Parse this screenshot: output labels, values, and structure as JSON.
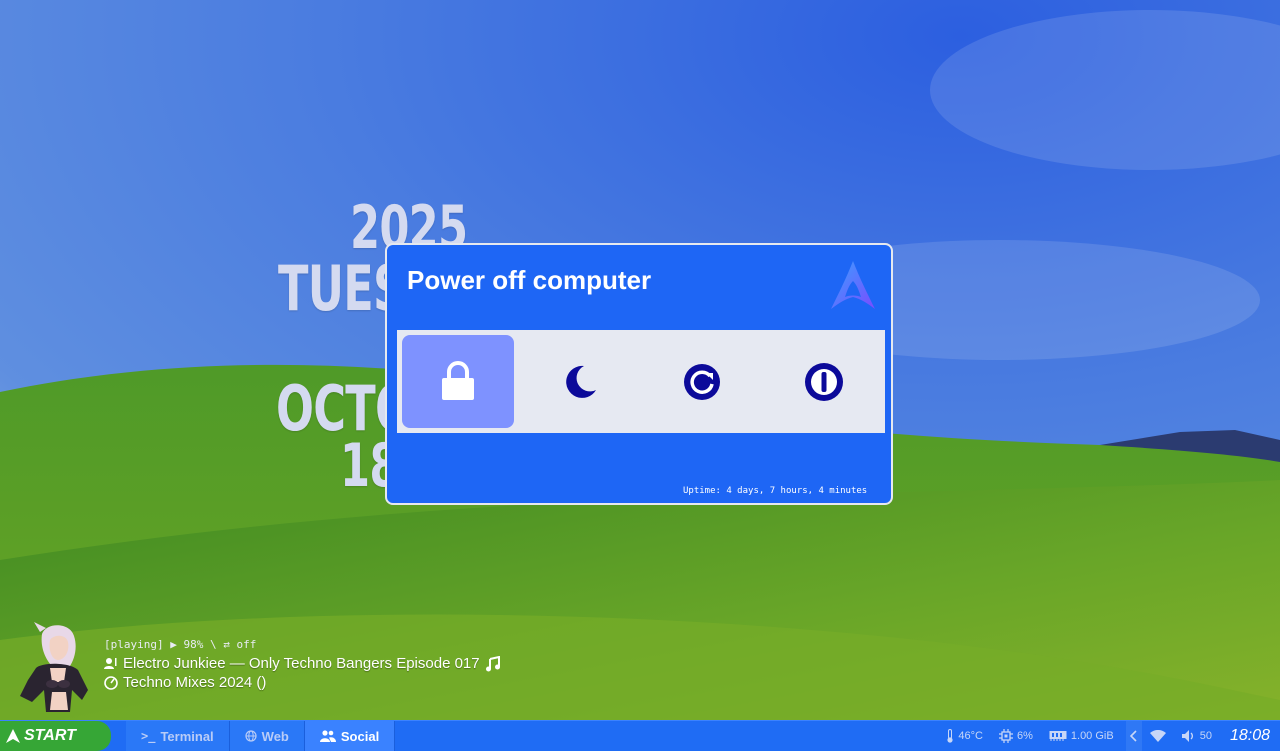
{
  "desktop": {
    "clock": {
      "year": "2025",
      "weekday": "TUESDAY",
      "month": "OCTOBER",
      "date": "18"
    }
  },
  "power_dialog": {
    "title": "Power off computer",
    "options": [
      {
        "name": "lock",
        "icon": "lock-icon",
        "selected": true
      },
      {
        "name": "suspend",
        "icon": "moon-icon",
        "selected": false
      },
      {
        "name": "reboot",
        "icon": "reboot-icon",
        "selected": false
      },
      {
        "name": "shutdown",
        "icon": "power-icon",
        "selected": false
      }
    ],
    "uptime": "Uptime: 4 days, 7 hours, 4 minutes",
    "colors": {
      "background": "#1e66f5",
      "options_bg": "#e6e9f2",
      "selected": "#7e92ff",
      "icon": "#0c0a9a"
    }
  },
  "music": {
    "status": "[playing] ▶ 98% \\ ⇄ off",
    "track": "Electro Junkiee — Only Techno Bangers Episode 017",
    "album": "Techno Mixes 2024 ()"
  },
  "taskbar": {
    "start_label": "START",
    "tabs": [
      {
        "label": "Terminal",
        "icon": "terminal-icon",
        "active": false
      },
      {
        "label": "Web",
        "icon": "globe-icon",
        "active": false
      },
      {
        "label": "Social",
        "icon": "users-icon",
        "active": true
      }
    ],
    "tray": {
      "temperature": "46°C",
      "cpu": "6%",
      "memory": "1.00 GiB",
      "volume": "50",
      "clock": "18:08"
    },
    "colors": {
      "bar": "#1f6cf4",
      "start": "#36a636"
    }
  }
}
